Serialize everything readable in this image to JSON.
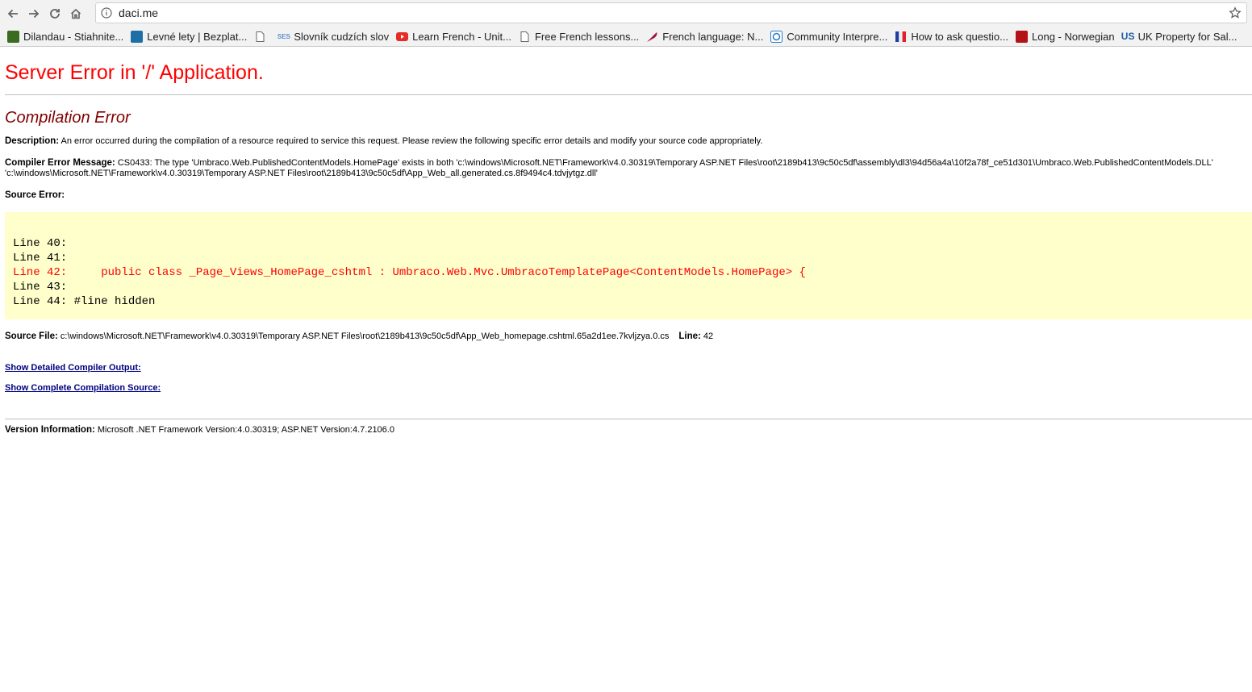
{
  "browser": {
    "url": "daci.me",
    "bookmarks": [
      {
        "label": "Dilandau - Stiahnite...",
        "icon": "dilandau-favicon",
        "color": "#3a6b1f"
      },
      {
        "label": "Levné lety | Bezplat...",
        "icon": "kiwi-favicon",
        "color": "#1d6fa5"
      },
      {
        "label": "",
        "icon": "page-icon",
        "color": "#666666"
      },
      {
        "label": "Slovník cudzích slov",
        "icon": "ses-favicon",
        "color": "#5b8fd1"
      },
      {
        "label": "Learn French - Unit...",
        "icon": "youtube-favicon",
        "color": "#e52d27"
      },
      {
        "label": "Free French lessons...",
        "icon": "page-icon",
        "color": "#666666"
      },
      {
        "label": "French language: N...",
        "icon": "quill-favicon",
        "color": "#a0143c"
      },
      {
        "label": "Community Interpre...",
        "icon": "community-favicon",
        "color": "#2a7cc7"
      },
      {
        "label": "How to ask questio...",
        "icon": "flag-favicon",
        "color": "#1e3fa0"
      },
      {
        "label": "Long - Norwegian",
        "icon": "long-favicon",
        "color": "#b31217"
      },
      {
        "label": "UK Property for Sal...",
        "icon": "us-favicon",
        "color": "#1f5fa8"
      }
    ]
  },
  "page": {
    "title": "Server Error in '/' Application.",
    "subtitle": "Compilation Error",
    "description_label": "Description:",
    "description_text": " An error occurred during the compilation of a resource required to service this request. Please review the following specific error details and modify your source code appropriately.",
    "compiler_label": "Compiler Error Message:",
    "compiler_text_1": " CS0433: The type 'Umbraco.Web.PublishedContentModels.HomePage' exists in both 'c:\\windows\\Microsoft.NET\\Framework\\v4.0.30319\\Temporary ASP.NET Files\\root\\2189b413\\9c50c5df\\assembly\\dl3\\94d56a4a\\10f2a78f_ce51d301\\Umbraco.Web.PublishedContentModels.DLL'",
    "compiler_text_2": "'c:\\windows\\Microsoft.NET\\Framework\\v4.0.30319\\Temporary ASP.NET Files\\root\\2189b413\\9c50c5df\\App_Web_all.generated.cs.8f9494c4.tdvjytgz.dll'",
    "source_error_label": "Source Error:",
    "code_lines": [
      {
        "text": "Line 40:",
        "error": false
      },
      {
        "text": "Line 41:",
        "error": false
      },
      {
        "text": "Line 42:     public class _Page_Views_HomePage_cshtml : Umbraco.Web.Mvc.UmbracoTemplatePage<ContentModels.HomePage> {",
        "error": true
      },
      {
        "text": "Line 43:",
        "error": false
      },
      {
        "text": "Line 44: #line hidden",
        "error": false
      }
    ],
    "source_file_label": "Source File:",
    "source_file_path": " c:\\windows\\Microsoft.NET\\Framework\\v4.0.30319\\Temporary ASP.NET Files\\root\\2189b413\\9c50c5df\\App_Web_homepage.cshtml.65a2d1ee.7kvljzya.0.cs",
    "line_label": "Line:",
    "line_number": " 42",
    "link_compiler_output": "Show Detailed Compiler Output:",
    "link_compilation_source": "Show Complete Compilation Source:",
    "version_label": "Version Information:",
    "version_text": " Microsoft .NET Framework Version:4.0.30319; ASP.NET Version:4.7.2106.0"
  }
}
